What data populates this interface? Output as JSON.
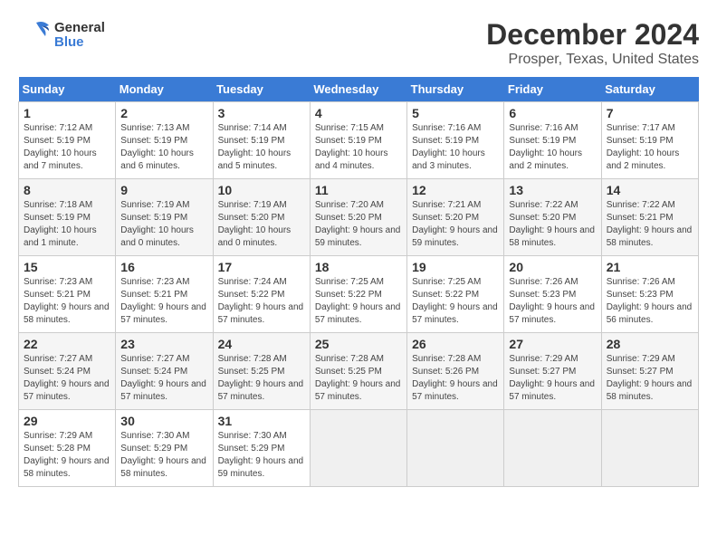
{
  "logo": {
    "line1": "General",
    "line2": "Blue"
  },
  "title": "December 2024",
  "subtitle": "Prosper, Texas, United States",
  "days_of_week": [
    "Sunday",
    "Monday",
    "Tuesday",
    "Wednesday",
    "Thursday",
    "Friday",
    "Saturday"
  ],
  "weeks": [
    [
      {
        "day": "1",
        "info": "Sunrise: 7:12 AM\nSunset: 5:19 PM\nDaylight: 10 hours and 7 minutes."
      },
      {
        "day": "2",
        "info": "Sunrise: 7:13 AM\nSunset: 5:19 PM\nDaylight: 10 hours and 6 minutes."
      },
      {
        "day": "3",
        "info": "Sunrise: 7:14 AM\nSunset: 5:19 PM\nDaylight: 10 hours and 5 minutes."
      },
      {
        "day": "4",
        "info": "Sunrise: 7:15 AM\nSunset: 5:19 PM\nDaylight: 10 hours and 4 minutes."
      },
      {
        "day": "5",
        "info": "Sunrise: 7:16 AM\nSunset: 5:19 PM\nDaylight: 10 hours and 3 minutes."
      },
      {
        "day": "6",
        "info": "Sunrise: 7:16 AM\nSunset: 5:19 PM\nDaylight: 10 hours and 2 minutes."
      },
      {
        "day": "7",
        "info": "Sunrise: 7:17 AM\nSunset: 5:19 PM\nDaylight: 10 hours and 2 minutes."
      }
    ],
    [
      {
        "day": "8",
        "info": "Sunrise: 7:18 AM\nSunset: 5:19 PM\nDaylight: 10 hours and 1 minute."
      },
      {
        "day": "9",
        "info": "Sunrise: 7:19 AM\nSunset: 5:19 PM\nDaylight: 10 hours and 0 minutes."
      },
      {
        "day": "10",
        "info": "Sunrise: 7:19 AM\nSunset: 5:20 PM\nDaylight: 10 hours and 0 minutes."
      },
      {
        "day": "11",
        "info": "Sunrise: 7:20 AM\nSunset: 5:20 PM\nDaylight: 9 hours and 59 minutes."
      },
      {
        "day": "12",
        "info": "Sunrise: 7:21 AM\nSunset: 5:20 PM\nDaylight: 9 hours and 59 minutes."
      },
      {
        "day": "13",
        "info": "Sunrise: 7:22 AM\nSunset: 5:20 PM\nDaylight: 9 hours and 58 minutes."
      },
      {
        "day": "14",
        "info": "Sunrise: 7:22 AM\nSunset: 5:21 PM\nDaylight: 9 hours and 58 minutes."
      }
    ],
    [
      {
        "day": "15",
        "info": "Sunrise: 7:23 AM\nSunset: 5:21 PM\nDaylight: 9 hours and 58 minutes."
      },
      {
        "day": "16",
        "info": "Sunrise: 7:23 AM\nSunset: 5:21 PM\nDaylight: 9 hours and 57 minutes."
      },
      {
        "day": "17",
        "info": "Sunrise: 7:24 AM\nSunset: 5:22 PM\nDaylight: 9 hours and 57 minutes."
      },
      {
        "day": "18",
        "info": "Sunrise: 7:25 AM\nSunset: 5:22 PM\nDaylight: 9 hours and 57 minutes."
      },
      {
        "day": "19",
        "info": "Sunrise: 7:25 AM\nSunset: 5:22 PM\nDaylight: 9 hours and 57 minutes."
      },
      {
        "day": "20",
        "info": "Sunrise: 7:26 AM\nSunset: 5:23 PM\nDaylight: 9 hours and 57 minutes."
      },
      {
        "day": "21",
        "info": "Sunrise: 7:26 AM\nSunset: 5:23 PM\nDaylight: 9 hours and 56 minutes."
      }
    ],
    [
      {
        "day": "22",
        "info": "Sunrise: 7:27 AM\nSunset: 5:24 PM\nDaylight: 9 hours and 57 minutes."
      },
      {
        "day": "23",
        "info": "Sunrise: 7:27 AM\nSunset: 5:24 PM\nDaylight: 9 hours and 57 minutes."
      },
      {
        "day": "24",
        "info": "Sunrise: 7:28 AM\nSunset: 5:25 PM\nDaylight: 9 hours and 57 minutes."
      },
      {
        "day": "25",
        "info": "Sunrise: 7:28 AM\nSunset: 5:25 PM\nDaylight: 9 hours and 57 minutes."
      },
      {
        "day": "26",
        "info": "Sunrise: 7:28 AM\nSunset: 5:26 PM\nDaylight: 9 hours and 57 minutes."
      },
      {
        "day": "27",
        "info": "Sunrise: 7:29 AM\nSunset: 5:27 PM\nDaylight: 9 hours and 57 minutes."
      },
      {
        "day": "28",
        "info": "Sunrise: 7:29 AM\nSunset: 5:27 PM\nDaylight: 9 hours and 58 minutes."
      }
    ],
    [
      {
        "day": "29",
        "info": "Sunrise: 7:29 AM\nSunset: 5:28 PM\nDaylight: 9 hours and 58 minutes."
      },
      {
        "day": "30",
        "info": "Sunrise: 7:30 AM\nSunset: 5:29 PM\nDaylight: 9 hours and 58 minutes."
      },
      {
        "day": "31",
        "info": "Sunrise: 7:30 AM\nSunset: 5:29 PM\nDaylight: 9 hours and 59 minutes."
      },
      null,
      null,
      null,
      null
    ]
  ]
}
